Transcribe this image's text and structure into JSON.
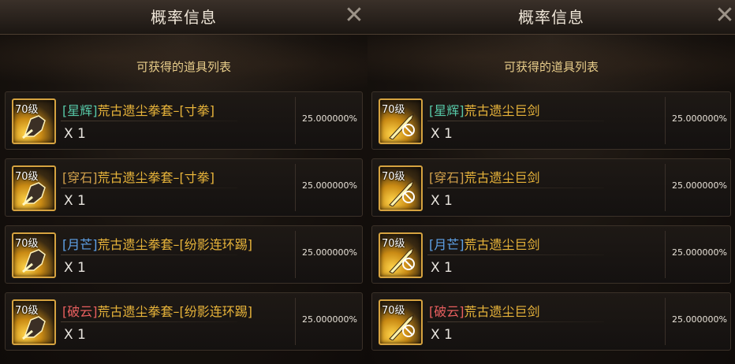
{
  "colors": {
    "tag_star": "#56c7a6",
    "tag_pierce": "#d2a14c",
    "tag_moon": "#5fa2e8",
    "tag_cloud": "#e85f5f",
    "item_gold": "#e8b43a"
  },
  "panels": [
    {
      "title": "概率信息",
      "subtitle": "可获得的道具列表",
      "close_icon": "close-x-icon",
      "items": [
        {
          "level": "70级",
          "tag": "[星辉]",
          "tag_color": "#56c7a6",
          "name": "荒古遗尘拳套–[寸拳]",
          "qty": "X 1",
          "rate": "25.000000%",
          "icon": "gauntlet-icon"
        },
        {
          "level": "70级",
          "tag": "[穿石]",
          "tag_color": "#d2a14c",
          "name": "荒古遗尘拳套–[寸拳]",
          "qty": "X 1",
          "rate": "25.000000%",
          "icon": "gauntlet-icon"
        },
        {
          "level": "70级",
          "tag": "[月芒]",
          "tag_color": "#5fa2e8",
          "name": "荒古遗尘拳套–[纷影连环踢]",
          "qty": "X 1",
          "rate": "25.000000%",
          "icon": "gauntlet-icon"
        },
        {
          "level": "70级",
          "tag": "[破云]",
          "tag_color": "#e85f5f",
          "name": "荒古遗尘拳套–[纷影连环踢]",
          "qty": "X 1",
          "rate": "25.000000%",
          "icon": "gauntlet-icon"
        }
      ]
    },
    {
      "title": "概率信息",
      "subtitle": "可获得的道具列表",
      "close_icon": "close-x-icon",
      "items": [
        {
          "level": "70级",
          "tag": "[星辉]",
          "tag_color": "#56c7a6",
          "name": "荒古遗尘巨剑",
          "qty": "X 1",
          "rate": "25.000000%",
          "icon": "greatsword-icon"
        },
        {
          "level": "70级",
          "tag": "[穿石]",
          "tag_color": "#d2a14c",
          "name": "荒古遗尘巨剑",
          "qty": "X 1",
          "rate": "25.000000%",
          "icon": "greatsword-icon"
        },
        {
          "level": "70级",
          "tag": "[月芒]",
          "tag_color": "#5fa2e8",
          "name": "荒古遗尘巨剑",
          "qty": "X 1",
          "rate": "25.000000%",
          "icon": "greatsword-icon"
        },
        {
          "level": "70级",
          "tag": "[破云]",
          "tag_color": "#e85f5f",
          "name": "荒古遗尘巨剑",
          "qty": "X 1",
          "rate": "25.000000%",
          "icon": "greatsword-icon"
        }
      ]
    }
  ]
}
